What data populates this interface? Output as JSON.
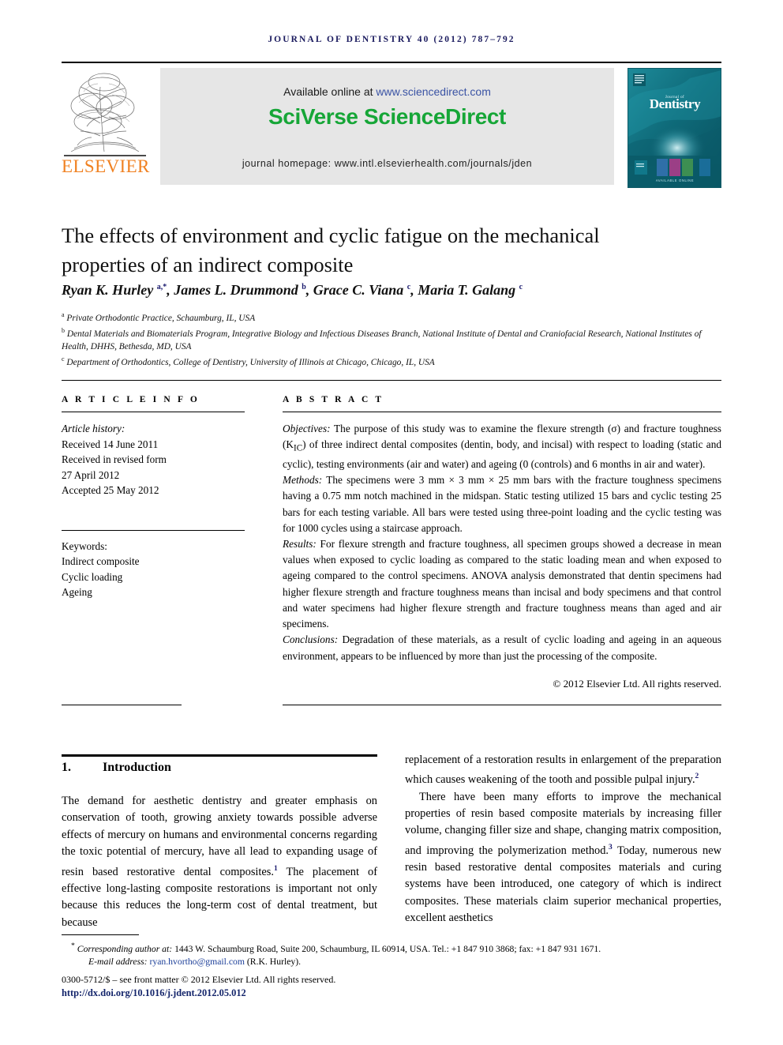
{
  "running_head": "Journal of Dentistry 40 (2012) 787–792",
  "masthead": {
    "publisher_name": "ELSEVIER",
    "available_text": "Available online at ",
    "available_url": "www.sciencedirect.com",
    "sciencedirect_logo": "SciVerse ScienceDirect",
    "homepage_text": "journal homepage: www.intl.elsevierhealth.com/journals/jden",
    "cover_title": "Dentistry",
    "cover_kicker": "Journal of",
    "colors": {
      "elsevier_orange": "#f08121",
      "sciencedirect_green": "#16a637",
      "link_blue": "#3a53a4",
      "banner_gray": "#e6e6e6",
      "cover_teal": "#14707f",
      "running_head_navy": "#1a1a5e"
    }
  },
  "article": {
    "title": "The effects of environment and cyclic fatigue on the mechanical properties of an indirect composite",
    "authors_html": "Ryan K. Hurley <sup>a,*</sup>, James L. Drummond <sup>b</sup>, Grace C. Viana <sup>c</sup>, Maria T. Galang <sup>c</sup>",
    "affiliations": [
      {
        "marker": "a",
        "text": "Private Orthodontic Practice, Schaumburg, IL, USA"
      },
      {
        "marker": "b",
        "text": "Dental Materials and Biomaterials Program, Integrative Biology and Infectious Diseases Branch, National Institute of Dental and Craniofacial Research, National Institutes of Health, DHHS, Bethesda, MD, USA"
      },
      {
        "marker": "c",
        "text": "Department of Orthodontics, College of Dentistry, University of Illinois at Chicago, Chicago, IL, USA"
      }
    ]
  },
  "article_info": {
    "heading": "A R T I C L E   I N F O",
    "history_label": "Article history:",
    "history_lines": [
      "Received 14 June 2011",
      "Received in revised form",
      "27 April 2012",
      "Accepted 25 May 2012"
    ],
    "keywords_label": "Keywords:",
    "keywords": [
      "Indirect composite",
      "Cyclic loading",
      "Ageing"
    ]
  },
  "abstract": {
    "heading": "A B S T R A C T",
    "sections": [
      {
        "label": "Objectives:",
        "text": " The purpose of this study was to examine the flexure strength (σ) and fracture toughness (K<sub>IC</sub>) of three indirect dental composites (dentin, body, and incisal) with respect to loading (static and cyclic), testing environments (air and water) and ageing (0 (controls) and 6 months in air and water)."
      },
      {
        "label": "Methods:",
        "text": " The specimens were 3 mm × 3 mm × 25 mm bars with the fracture toughness specimens having a 0.75 mm notch machined in the midspan. Static testing utilized 15 bars and cyclic testing 25 bars for each testing variable. All bars were tested using three-point loading and the cyclic testing was for 1000 cycles using a staircase approach."
      },
      {
        "label": "Results:",
        "text": " For flexure strength and fracture toughness, all specimen groups showed a decrease in mean values when exposed to cyclic loading as compared to the static loading mean and when exposed to ageing compared to the control specimens. ANOVA analysis demonstrated that dentin specimens had higher flexure strength and fracture toughness means than incisal and body specimens and that control and water specimens had higher flexure strength and fracture toughness means than aged and air specimens."
      },
      {
        "label": "Conclusions:",
        "text": " Degradation of these materials, as a result of cyclic loading and ageing in an aqueous environment, appears to be influenced by more than just the processing of the composite."
      }
    ],
    "copyright": "© 2012 Elsevier Ltd. All rights reserved."
  },
  "body": {
    "section_number": "1.",
    "section_title": "Introduction",
    "left_column_html": "The demand for aesthetic dentistry and greater emphasis on conservation of tooth, growing anxiety towards possible adverse effects of mercury on humans and environmental concerns regarding the toxic potential of mercury, have all lead to expanding usage of resin based restorative dental composites.<sup class=\"ref\">1</sup> The placement of effective long-lasting composite restorations is important not only because this reduces the long-term cost of dental treatment, but because",
    "right_column_paragraphs": [
      "replacement of a restoration results in enlargement of the preparation which causes weakening of the tooth and possible pulpal injury.<sup class=\"ref\">2</sup>",
      "There have been many efforts to improve the mechanical properties of resin based composite materials by increasing filler volume, changing filler size and shape, changing matrix composition, and improving the polymerization method.<sup class=\"ref\">3</sup> Today, numerous new resin based restorative dental composites materials and curing systems have been introduced, one category of which is indirect composites. These materials claim superior mechanical properties, excellent aesthetics"
    ]
  },
  "footer": {
    "corresponding_marker": "*",
    "corresponding_label": "Corresponding author at:",
    "corresponding_address": " 1443 W. Schaumburg Road, Suite 200, Schaumburg, IL 60914, USA. Tel.: +1 847 910 3868; fax: +1 847 931 1671.",
    "email_label": "E-mail address:",
    "email": "ryan.hvortho@gmail.com",
    "email_suffix": " (R.K. Hurley).",
    "issn_line": "0300-5712/$ – see front matter © 2012 Elsevier Ltd. All rights reserved.",
    "doi": "http://dx.doi.org/10.1016/j.jdent.2012.05.012"
  }
}
